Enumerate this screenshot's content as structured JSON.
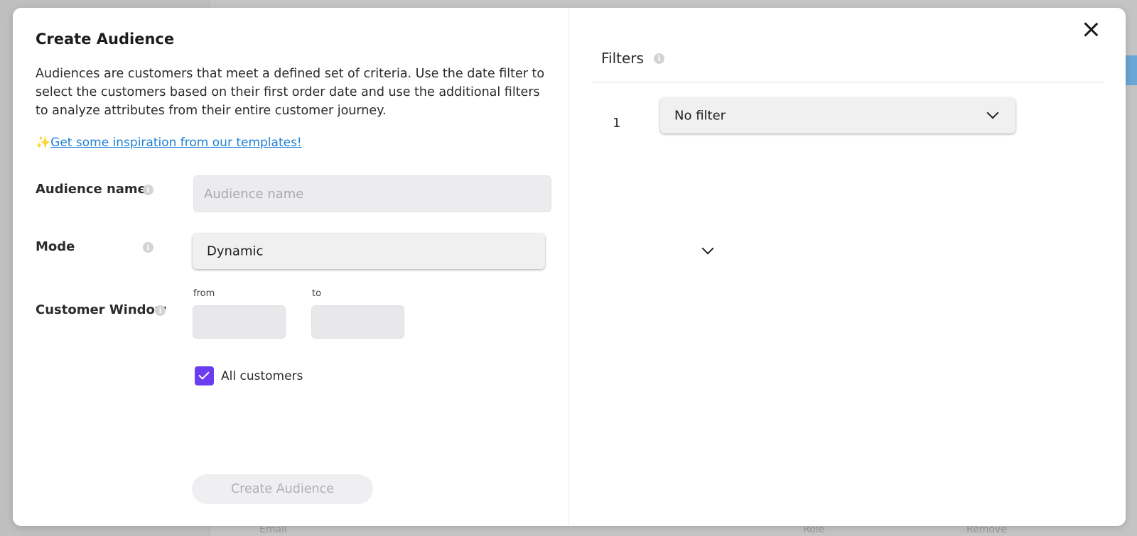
{
  "background": {
    "texts": [
      "Email",
      "Role",
      "Remove"
    ]
  },
  "modal": {
    "title": "Create Audience",
    "description": "Audiences are customers that meet a defined set of criteria. Use the date filter to select the customers based on their first order date and use the additional filters to analyze attributes from their entire customer journey.",
    "inspiration_emoji": "✨",
    "inspiration_link": "Get some inspiration from our templates!",
    "audience_name": {
      "label": "Audience name",
      "placeholder": "Audience name",
      "value": ""
    },
    "mode": {
      "label": "Mode",
      "selected": "Dynamic"
    },
    "customer_window": {
      "label": "Customer Window",
      "from_label": "from",
      "to_label": "to",
      "from_value": "",
      "to_value": ""
    },
    "all_customers": {
      "label": "All customers",
      "checked": true
    },
    "create_button": "Create Audience",
    "filters": {
      "title": "Filters",
      "items": [
        {
          "number": "1",
          "selected": "No filter"
        }
      ]
    }
  },
  "colors": {
    "accent": "#6b3df0",
    "link": "#1f7fd6"
  },
  "icons": {
    "info": "info-icon",
    "close": "close-icon",
    "chevron": "chevron-down-icon",
    "check": "check-icon"
  }
}
